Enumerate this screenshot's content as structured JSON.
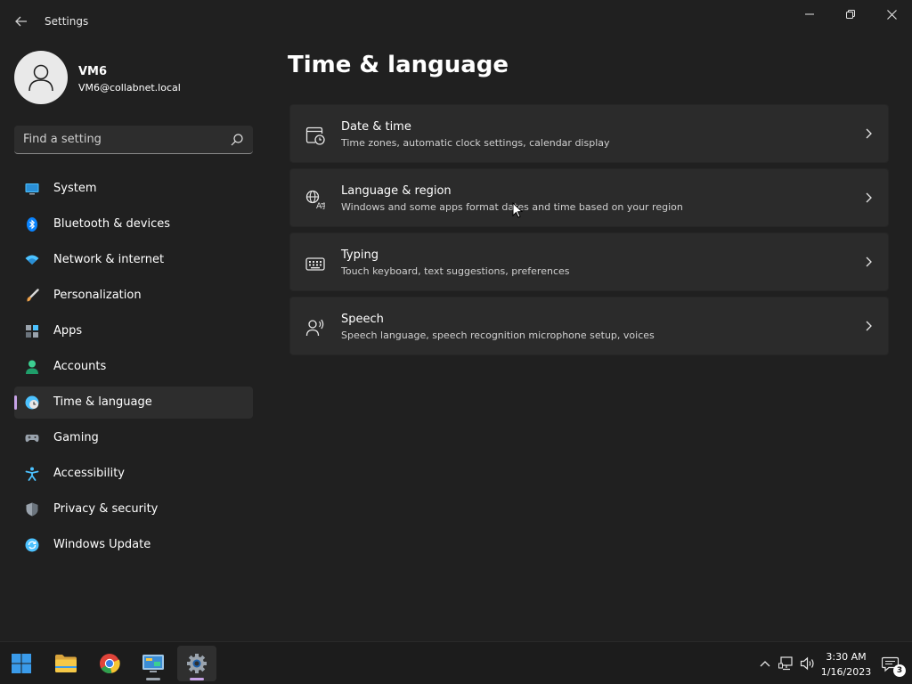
{
  "window": {
    "title": "Settings",
    "controls": [
      "minimize",
      "restore",
      "close"
    ]
  },
  "profile": {
    "name": "VM6",
    "email": "VM6@collabnet.local"
  },
  "search": {
    "placeholder": "Find a setting",
    "value": ""
  },
  "sidebar": {
    "items": [
      {
        "label": "System",
        "icon": "monitor-icon",
        "color": "#4cc2ff"
      },
      {
        "label": "Bluetooth & devices",
        "icon": "bluetooth-icon",
        "color": "#0a84ff"
      },
      {
        "label": "Network & internet",
        "icon": "wifi-icon",
        "color": "#4cc2ff"
      },
      {
        "label": "Personalization",
        "icon": "brush-icon",
        "color": "#f0a34a"
      },
      {
        "label": "Apps",
        "icon": "apps-icon",
        "color": "#9aa3ad"
      },
      {
        "label": "Accounts",
        "icon": "person-icon",
        "color": "#3ccf91"
      },
      {
        "label": "Time & language",
        "icon": "globe-clock-icon",
        "color": "#4cc2ff",
        "selected": true
      },
      {
        "label": "Gaming",
        "icon": "gamepad-icon",
        "color": "#9aa3ad"
      },
      {
        "label": "Accessibility",
        "icon": "accessibility-icon",
        "color": "#4cc2ff"
      },
      {
        "label": "Privacy & security",
        "icon": "shield-icon",
        "color": "#9aa3ad"
      },
      {
        "label": "Windows Update",
        "icon": "update-icon",
        "color": "#4cc2ff"
      }
    ]
  },
  "main": {
    "title": "Time & language",
    "cards": [
      {
        "title": "Date & time",
        "description": "Time zones, automatic clock settings, calendar display",
        "icon": "calendar-clock-icon"
      },
      {
        "title": "Language & region",
        "description": "Windows and some apps format dates and time based on your region",
        "icon": "language-icon"
      },
      {
        "title": "Typing",
        "description": "Touch keyboard, text suggestions, preferences",
        "icon": "keyboard-icon"
      },
      {
        "title": "Speech",
        "description": "Speech language, speech recognition microphone setup, voices",
        "icon": "speech-icon"
      }
    ]
  },
  "taskbar": {
    "apps": [
      {
        "name": "start-button",
        "icon": "windows-logo-icon"
      },
      {
        "name": "file-explorer",
        "icon": "folder-icon"
      },
      {
        "name": "chrome",
        "icon": "chrome-icon"
      },
      {
        "name": "control-panel",
        "icon": "control-panel-icon"
      },
      {
        "name": "settings",
        "icon": "gear-icon",
        "active": true
      }
    ],
    "clock": {
      "time": "3:30 AM",
      "date": "1/16/2023"
    },
    "notification_count": "3"
  },
  "colors": {
    "background": "#202020",
    "card": "#2b2b2b",
    "accent": "#c6a2e6",
    "taskbar": "#1c1c1c"
  }
}
